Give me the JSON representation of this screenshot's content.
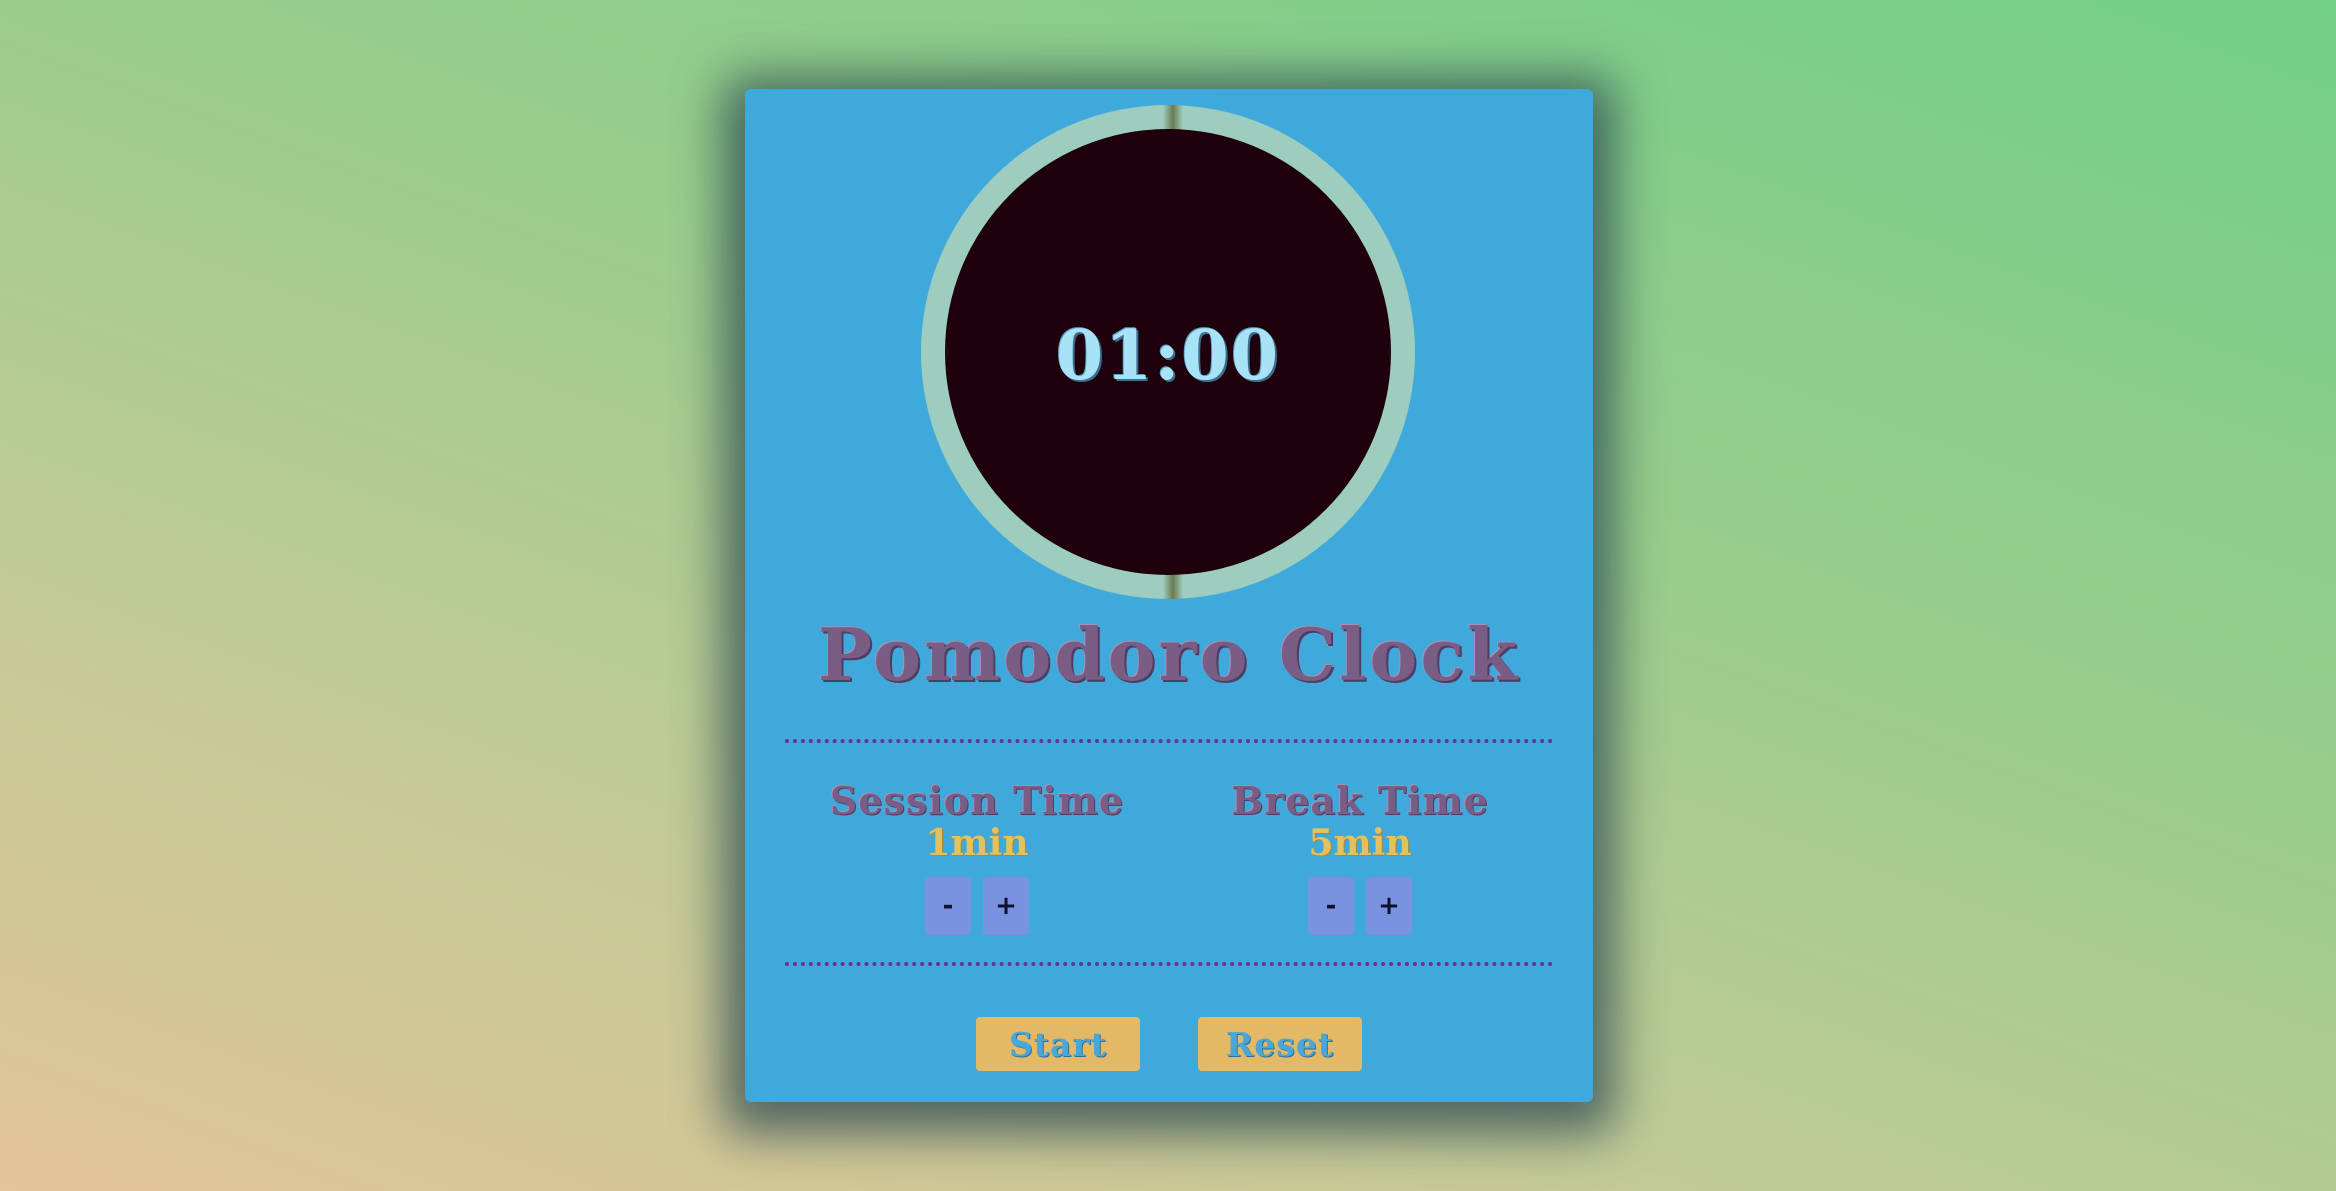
{
  "clock": {
    "time": "01:00"
  },
  "title": "Pomodoro Clock",
  "session": {
    "label": "Session Time",
    "value": "1min",
    "decrement": "-",
    "increment": "+"
  },
  "break": {
    "label": "Break Time",
    "value": "5min",
    "decrement": "-",
    "increment": "+"
  },
  "actions": {
    "start": "Start",
    "reset": "Reset"
  },
  "colors": {
    "card": "#3fa9dc",
    "clock_face": "#1f000d",
    "time_text": "#a8e2f7",
    "title_text": "#7a5d85",
    "value_text": "#e5c15c",
    "stepper_button": "#7a93de",
    "action_button": "#e4b965",
    "divider": "#6a2fa0"
  }
}
